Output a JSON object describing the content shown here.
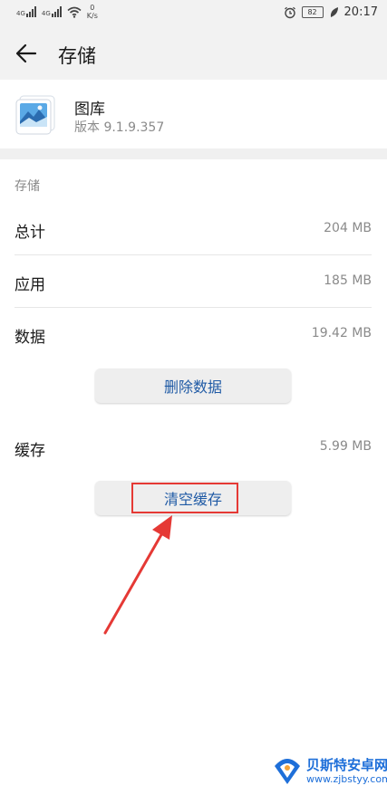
{
  "status_bar": {
    "net1_type": "4G",
    "net2_type": "4G",
    "speed_value": "0",
    "speed_unit": "K/s",
    "battery_level": "82",
    "time": "20:17"
  },
  "header": {
    "title": "存储"
  },
  "app": {
    "name": "图库",
    "version": "版本 9.1.9.357"
  },
  "storage": {
    "section_label": "存储",
    "rows": [
      {
        "label": "总计",
        "value": "204 MB"
      },
      {
        "label": "应用",
        "value": "185 MB"
      },
      {
        "label": "数据",
        "value": "19.42 MB"
      }
    ],
    "delete_data_label": "删除数据",
    "cache_label": "缓存",
    "cache_value": "5.99 MB",
    "clear_cache_label": "清空缓存"
  },
  "watermark": {
    "title": "贝斯特安卓网",
    "url": "www.zjbstyy.com"
  },
  "colors": {
    "accent": "#1f5aa5",
    "highlight": "#e53935",
    "header_bg": "#f2f2f2"
  }
}
